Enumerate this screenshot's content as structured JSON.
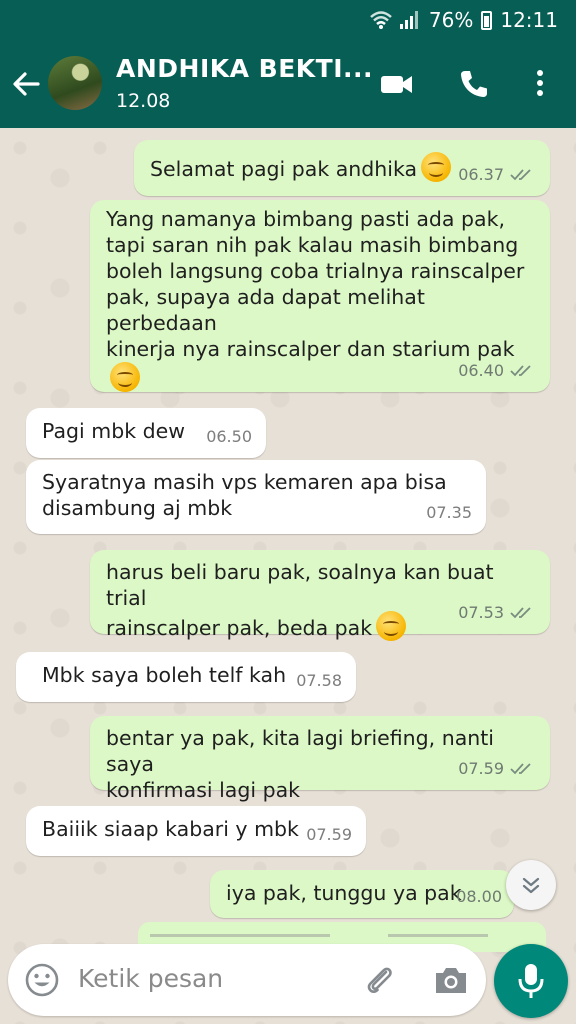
{
  "status_bar": {
    "battery": "76%",
    "time": "12:11"
  },
  "header": {
    "contact_name": "ANDHIKA BEKTI...",
    "status": "12.08"
  },
  "messages": [
    {
      "dir": "out",
      "text": "Selamat pagi pak andhika",
      "emoji": "smiling-face",
      "time": "06.37",
      "ticks": "double-check"
    },
    {
      "dir": "out",
      "text": "Yang namanya bimbang pasti ada pak,\ntapi saran nih pak kalau masih bimbang\nboleh langsung coba trialnya rainscalper\npak, supaya ada dapat melihat perbedaan\nkinerja nya rainscalper dan starium pak",
      "emoji": "smiling-face",
      "time": "06.40",
      "ticks": "double-check"
    },
    {
      "dir": "in",
      "text": "Pagi mbk dew",
      "time": "06.50"
    },
    {
      "dir": "in",
      "text": "Syaratnya masih vps kemaren apa bisa\ndisambung aj mbk",
      "time": "07.35"
    },
    {
      "dir": "out",
      "text": "harus beli baru pak, soalnya kan buat trial\nrainscalper pak, beda pak",
      "emoji": "smiling-face",
      "time": "07.53",
      "ticks": "double-check"
    },
    {
      "dir": "in",
      "text": "Mbk saya boleh telf kah",
      "time": "07.58"
    },
    {
      "dir": "out",
      "text": "bentar ya pak, kita lagi briefing, nanti saya\nkonfirmasi lagi pak",
      "time": "07.59",
      "ticks": "double-check"
    },
    {
      "dir": "in",
      "text": "Baiiik siaap kabari y mbk",
      "time": "07.59"
    },
    {
      "dir": "out",
      "text": "iya pak, tunggu ya pak",
      "time": "08.00"
    }
  ],
  "composer": {
    "placeholder": "Ketik pesan"
  },
  "colors": {
    "header": "#075e54",
    "outgoing": "#dcf8c6",
    "incoming": "#ffffff",
    "mic": "#00897b",
    "ticks": "#7a8c80"
  },
  "icons": [
    "wifi-icon",
    "signal-icon",
    "battery-icon",
    "back-arrow-icon",
    "video-call-icon",
    "voice-call-icon",
    "more-options-icon",
    "double-check-icon",
    "smiling-face-emoji",
    "scroll-down-icon",
    "emoji-icon",
    "attach-icon",
    "camera-icon",
    "mic-icon"
  ]
}
